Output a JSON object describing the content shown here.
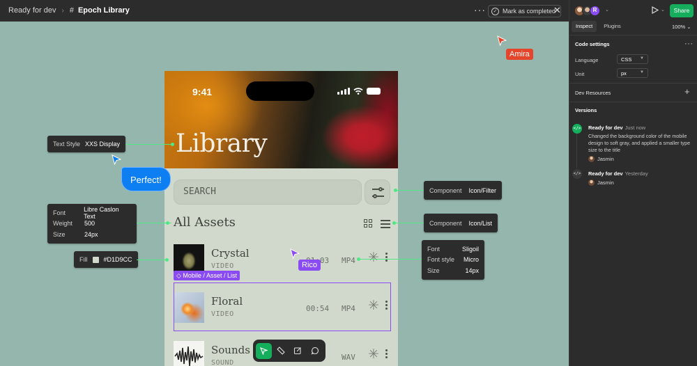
{
  "topbar": {
    "breadcrumb_status": "Ready for dev",
    "breadcrumb_file": "Epoch Library",
    "mark_completed": "Mark as completed"
  },
  "phone": {
    "time": "9:41",
    "title": "Library",
    "search_placeholder": "SEARCH",
    "section_title": "All Assets",
    "assets": [
      {
        "name": "Crystal",
        "kind": "VIDEO",
        "duration": "01:03",
        "format": "MP4"
      },
      {
        "name": "Floral",
        "kind": "VIDEO",
        "duration": "00:54",
        "format": "MP4"
      },
      {
        "name": "Sounds of",
        "kind": "SOUND",
        "duration": "",
        "format": "WAV"
      }
    ]
  },
  "selection": {
    "label": "Mobile / Asset / List"
  },
  "annotations": {
    "text_style": {
      "key": "Text Style",
      "value": "XXS Display"
    },
    "font_block": {
      "font_key": "Font",
      "font_value": "Libre Caslon Text",
      "weight_key": "Weight",
      "weight_value": "500",
      "size_key": "Size",
      "size_value": "24px"
    },
    "fill": {
      "key": "Fill",
      "value": "#D1D9CC"
    },
    "component_filter": {
      "key": "Component",
      "value": "Icon/Filter"
    },
    "component_list": {
      "key": "Component",
      "value": "Icon/List"
    },
    "font_block_2": {
      "font_key": "Font",
      "font_value": "Sligoil",
      "style_key": "Font style",
      "style_value": "Micro",
      "size_key": "Size",
      "size_value": "14px"
    }
  },
  "collaborators": {
    "amira": {
      "name": "Amira",
      "color": "#e5452b"
    },
    "rico": {
      "name": "Rico",
      "color": "#8a4cf2"
    },
    "comment_bubble": "Perfect!",
    "avatar_initial": "R"
  },
  "panel": {
    "tabs": [
      "Inspect",
      "Plugins"
    ],
    "zoom": "100%",
    "share": "Share",
    "code_settings": "Code settings",
    "language_label": "Language",
    "language_value": "CSS",
    "unit_label": "Unit",
    "unit_value": "px",
    "dev_resources": "Dev Resources",
    "versions": "Versions",
    "version_list": [
      {
        "title": "Ready for dev",
        "when": "Just now",
        "description": "Changed the background color of the mobile design to soft gray, and applied a smaller type size to the title",
        "user": "Jasmin"
      },
      {
        "title": "Ready for dev",
        "when": "Yesterday",
        "user": "Jasmin"
      }
    ]
  },
  "colors": {
    "accent_green": "#14ae5c",
    "connector": "#4fe884",
    "selection": "#8a4cf2",
    "canvas": "#95b6ac",
    "app_bg": "#d1d9cc"
  }
}
